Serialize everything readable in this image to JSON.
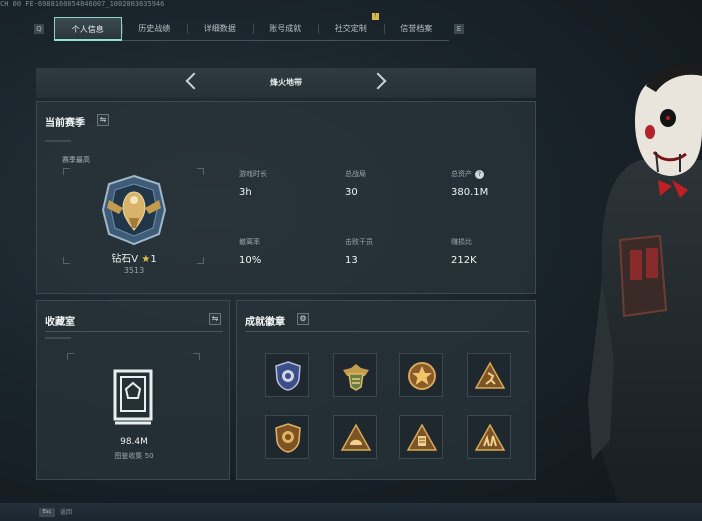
{
  "top_id_text": "CH 00 FE-6988160054846007_1002003635946",
  "tabs": {
    "left_key": "Q",
    "right_key": "E",
    "items": [
      {
        "label": "个人信息",
        "active": true
      },
      {
        "label": "历史战绩",
        "active": false
      },
      {
        "label": "详细数据",
        "active": false
      },
      {
        "label": "账号成就",
        "active": false
      },
      {
        "label": "社交定制",
        "active": false
      },
      {
        "label": "信誉档案",
        "active": false
      }
    ],
    "badge": "!"
  },
  "mode": {
    "title": "烽火地带"
  },
  "season": {
    "title": "当前赛季",
    "switch_icon": "swap-icon",
    "best_label": "赛季最高",
    "rank": {
      "name": "钻石V",
      "star_level": "1",
      "score": "3513",
      "emblem_icon": "eagle-rank-emblem"
    },
    "stats": [
      {
        "label": "游戏时长",
        "value": "3h"
      },
      {
        "label": "总战局",
        "value": "30"
      },
      {
        "label": "总资产",
        "value": "380.1M",
        "help": "?"
      },
      {
        "label": "撤离率",
        "value": "10%"
      },
      {
        "label": "击败干员",
        "value": "13"
      },
      {
        "label": "赚损比",
        "value": "212K"
      }
    ]
  },
  "collection": {
    "title": "收藏室",
    "switch_icon": "swap-icon",
    "vault_icon": "vault-icon",
    "value": "98.4M",
    "collected_label": "图鉴收集",
    "collected_count": "50"
  },
  "achievements": {
    "title": "成就徽章",
    "settings_icon": "gear-icon",
    "badges": [
      {
        "icon": "police-shield-badge-icon"
      },
      {
        "icon": "winged-crest-badge-icon"
      },
      {
        "icon": "star-medal-badge-icon"
      },
      {
        "icon": "runner-triangle-badge-icon"
      },
      {
        "icon": "lion-shield-badge-icon"
      },
      {
        "icon": "helmet-triangle-badge-icon"
      },
      {
        "icon": "building-triangle-badge-icon"
      },
      {
        "icon": "soldiers-triangle-badge-icon"
      }
    ]
  },
  "footer": {
    "key": "Esc",
    "label": "返回"
  },
  "colors": {
    "accent": "#8fe2cf",
    "gold": "#d8b84a",
    "panel": "#28343a"
  }
}
